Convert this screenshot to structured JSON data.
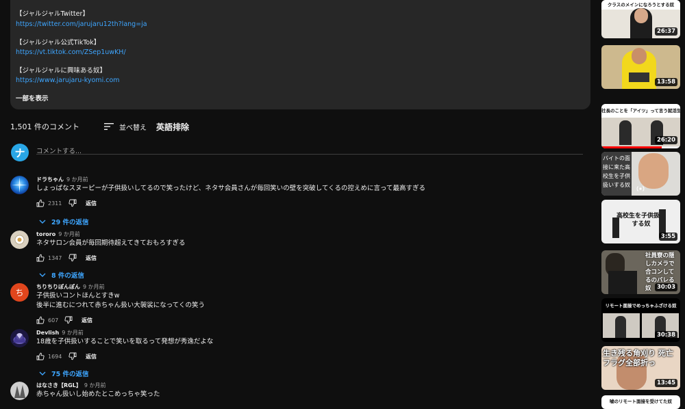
{
  "description": {
    "lines": [
      {
        "text": "【ジャルジャルTwitter】",
        "type": "text"
      },
      {
        "text": "https://twitter.com/jarujaru12th?lang=ja",
        "type": "link"
      },
      {
        "text": "【ジャルジャル公式TikTok】",
        "type": "text"
      },
      {
        "text": "https://vt.tiktok.com/ZSep1uwKH/",
        "type": "link"
      },
      {
        "text": "【ジャルジャルに興味ある奴】",
        "type": "text"
      },
      {
        "text": "https://www.jarujaru-kyomi.com",
        "type": "link"
      }
    ],
    "show_more": "一部を表示"
  },
  "comments_header": {
    "count": "1,501 件のコメント",
    "sort_label": "並べ替え",
    "filter_label": "英語排除"
  },
  "add_comment": {
    "placeholder": "コメントする...",
    "avatar_letter": "ナ",
    "avatar_color": "#29a6e6"
  },
  "comments": [
    {
      "author": "ドラちゃん",
      "time": "9 か月前",
      "text": [
        "しょっぱなスヌーピーが子供扱いしてるので笑ったけど、ネタサ会員さんが毎回笑いの壁を突破してくるの控えめに言って最高すぎる"
      ],
      "likes": "2311",
      "reply": "返信",
      "replies": "29 件の返信"
    },
    {
      "author": "tororo",
      "time": "9 か月前",
      "text": [
        "ネタサロン会員が毎回期待超えてきておもろすぎる"
      ],
      "likes": "1347",
      "reply": "返信",
      "replies": "8 件の返信"
    },
    {
      "author": "ちりちりぽんぽん",
      "time": "9 か月前",
      "text": [
        "子供扱いコントほんとすきw",
        "後半に進むにつれて赤ちゃん扱い大袈裟になってくの笑う"
      ],
      "likes": "607",
      "reply": "返信",
      "avatar_letter": "ち",
      "avatar_color": "#e0461d"
    },
    {
      "author": "Devlish",
      "time": "9 か月前",
      "text": [
        "18歳を子供扱いすることで笑いを取るって発想が秀逸だよな"
      ],
      "likes": "1694",
      "reply": "返信",
      "replies": "75 件の返信"
    },
    {
      "author": "はなさき【RGL】",
      "time": "9 か月前",
      "text": [
        "赤ちゃん扱いし始めたとこめっちゃ笑った"
      ]
    }
  ],
  "sidebar": [
    {
      "duration": "26:37",
      "caption": "クラスのメインになろうとする奴"
    },
    {
      "duration": "13:58"
    },
    {
      "duration": "26:20",
      "caption": "社長のことを「アイツ」って言う就活生な奴"
    },
    {
      "caption": "バイトの面接に来た高校生を子供扱いする奴"
    },
    {
      "duration": "3:55",
      "caption": "高校生を子供扱いする奴"
    },
    {
      "duration": "30:03",
      "caption": "社員寮の隠しカメラで合コンしてるのバレる奴"
    },
    {
      "duration": "30:38",
      "caption": "リモート面接でめっちゃふざける奴"
    },
    {
      "duration": "13:45",
      "caption": "生き残る角刈り 死亡フラグ全部折っ"
    },
    {
      "caption": "嘘のリモート面接を受けてた奴"
    }
  ]
}
